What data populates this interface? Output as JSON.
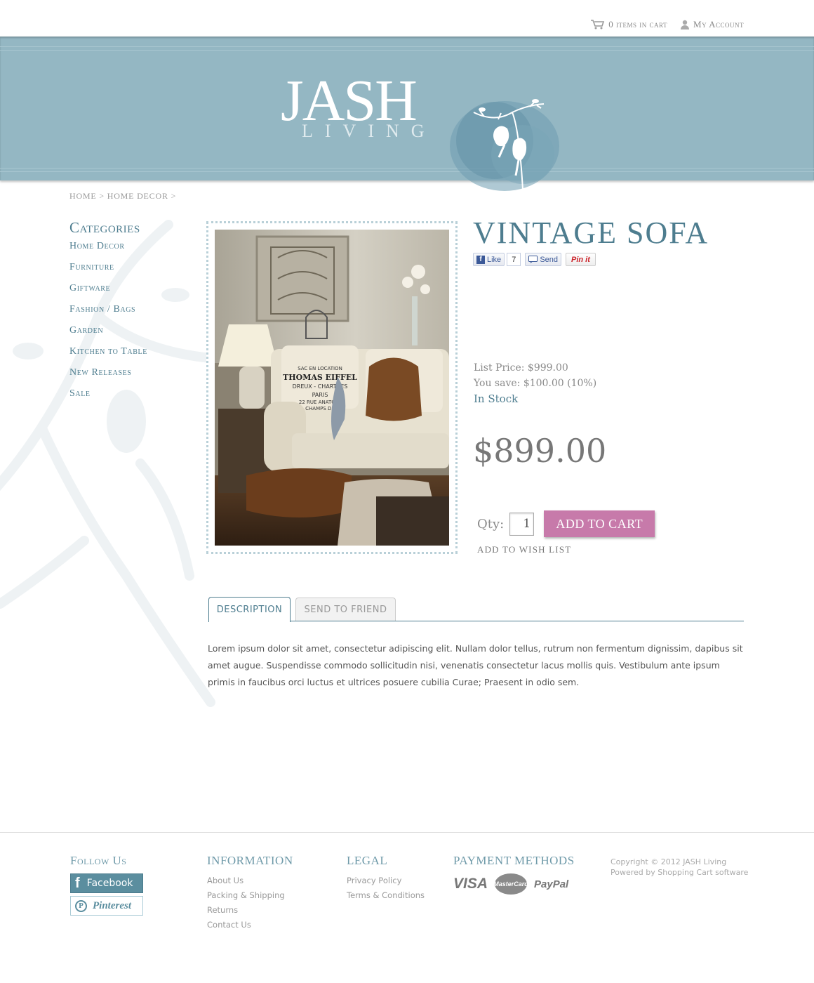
{
  "topbar": {
    "cart_label": "0 items in cart",
    "account_label": "My Account"
  },
  "header": {
    "brand": "JASH",
    "brand_sub": "LIVING"
  },
  "breadcrumb": {
    "items": [
      "HOME",
      "HOME DECOR"
    ],
    "separator": ">"
  },
  "sidebar": {
    "title": "Categories",
    "items": [
      {
        "label": "Home Decor"
      },
      {
        "label": "Furniture"
      },
      {
        "label": "Giftware"
      },
      {
        "label": "Fashion / Bags"
      },
      {
        "label": "Garden"
      },
      {
        "label": "Kitchen to Table"
      },
      {
        "label": "New Releases"
      },
      {
        "label": "Sale"
      }
    ]
  },
  "product": {
    "title": "VINTAGE SOFA",
    "list_price": "List Price: $999.00",
    "you_save": "You save: $100.00 (10%)",
    "stock": "In Stock",
    "price": "$899.00",
    "qty_label": "Qty:",
    "qty_value": "1",
    "add_to_cart": "ADD TO CART",
    "wishlist": "ADD TO WISH LIST",
    "pillow_text": [
      "SAC EN LOCATION",
      "THOMAS EIFFEL",
      "DREUX - CHARTRES",
      "PARIS",
      "22 RUE ANATOLE",
      "CHAMPS DE"
    ]
  },
  "social": {
    "like": "Like",
    "like_count": "7",
    "send": "Send",
    "pin": "Pin it"
  },
  "tabs": [
    {
      "label": "DESCRIPTION",
      "active": true
    },
    {
      "label": "SEND TO FRIEND",
      "active": false
    }
  ],
  "description": "Lorem ipsum dolor sit amet, consectetur adipiscing elit. Nullam dolor tellus, rutrum non fermentum dignissim, dapibus sit amet augue. Suspendisse commodo sollicitudin nisi, venenatis consectetur lacus mollis quis. Vestibulum ante ipsum primis in faucibus orci luctus et ultrices posuere cubilia Curae; Praesent in odio sem.",
  "footer": {
    "follow_title": "Follow Us",
    "facebook": "Facebook",
    "pinterest": "Pinterest",
    "info_title": "INFORMATION",
    "info_links": [
      "About Us",
      "Packing & Shipping",
      "Returns",
      "Contact Us"
    ],
    "legal_title": "LEGAL",
    "legal_links": [
      "Privacy Policy",
      "Terms & Conditions"
    ],
    "payment_title": "PAYMENT METHODS",
    "payment_visa": "VISA",
    "payment_mastercard": "MasterCard",
    "payment_paypal": "PayPal",
    "copyright_line1": "Copyright © 2012 JASH Living",
    "copyright_line2": "Powered by Shopping Cart software"
  },
  "colors": {
    "accent": "#4e7d8f",
    "header_band": "#94b7c3",
    "cart_button": "#c77aaa"
  }
}
